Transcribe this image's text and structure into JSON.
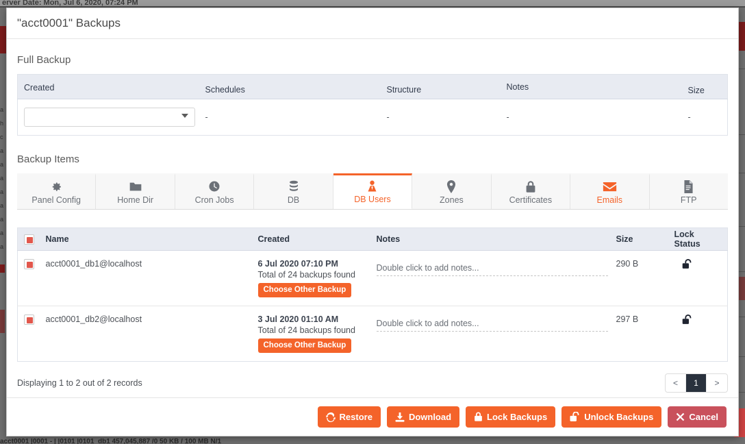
{
  "background": {
    "top_status_text": "erver Date: Mon, Jul 6, 2020, 07:24 PM",
    "bottom_row_text": "acct0001          |0001        -      |       |0101        |0101_db1            457,045,887 /0        50 KB / 100 MB       N/1",
    "left_gutter_chars": "a h c a a a a a a a a",
    "accent_red": "#7b1b1b"
  },
  "modal": {
    "title": "\"acct0001\" Backups"
  },
  "full_backup": {
    "section_title": "Full Backup",
    "columns": [
      "Created",
      "Schedules",
      "Structure",
      "Notes",
      "Size"
    ],
    "row": {
      "created_select_value": "",
      "created_select_placeholder": "",
      "schedules": "-",
      "structure": "-",
      "notes": "-",
      "size": "-"
    }
  },
  "backup_items": {
    "section_title": "Backup Items",
    "tabs": [
      {
        "label": "Panel Config",
        "icon": "gear-icon",
        "state": "normal"
      },
      {
        "label": "Home Dir",
        "icon": "folder-icon",
        "state": "normal"
      },
      {
        "label": "Cron Jobs",
        "icon": "clock-icon",
        "state": "normal"
      },
      {
        "label": "DB",
        "icon": "database-icon",
        "state": "normal"
      },
      {
        "label": "DB Users",
        "icon": "user-tie-icon",
        "state": "active"
      },
      {
        "label": "Zones",
        "icon": "map-pin-icon",
        "state": "normal"
      },
      {
        "label": "Certificates",
        "icon": "lock-icon",
        "state": "normal"
      },
      {
        "label": "Emails",
        "icon": "envelope-icon",
        "state": "hovered"
      },
      {
        "label": "FTP",
        "icon": "file-lines-icon",
        "state": "normal"
      }
    ],
    "table": {
      "columns": [
        "Name",
        "Created",
        "Notes",
        "Size",
        "Lock Status"
      ],
      "select_all_checked": true,
      "rows": [
        {
          "checked": true,
          "name": "acct0001_db1@localhost",
          "created_date": "6 Jul 2020 07:10 PM",
          "created_sub": "Total of 24 backups found",
          "choose_other_label": "Choose Other Backup",
          "notes_placeholder": "Double click to add notes...",
          "size": "290 B",
          "lock_status": "unlocked"
        },
        {
          "checked": true,
          "name": "acct0001_db2@localhost",
          "created_date": "3 Jul 2020 01:10 AM",
          "created_sub": "Total of 24 backups found",
          "choose_other_label": "Choose Other Backup",
          "notes_placeholder": "Double click to add notes...",
          "size": "297 B",
          "lock_status": "unlocked"
        }
      ]
    },
    "footer": {
      "records_text": "Displaying 1 to 2 out of 2 records",
      "pager": {
        "prev": "<",
        "current": "1",
        "next": ">"
      }
    }
  },
  "actions": [
    {
      "label": "Restore",
      "icon": "refresh-icon",
      "color": "#f4632a"
    },
    {
      "label": "Download",
      "icon": "download-icon",
      "color": "#f4632a"
    },
    {
      "label": "Lock Backups",
      "icon": "lock-closed-icon",
      "color": "#f4632a"
    },
    {
      "label": "Unlock Backups",
      "icon": "lock-open-icon",
      "color": "#f4632a"
    },
    {
      "label": "Cancel",
      "icon": "x-icon",
      "color": "#c9515c"
    }
  ]
}
